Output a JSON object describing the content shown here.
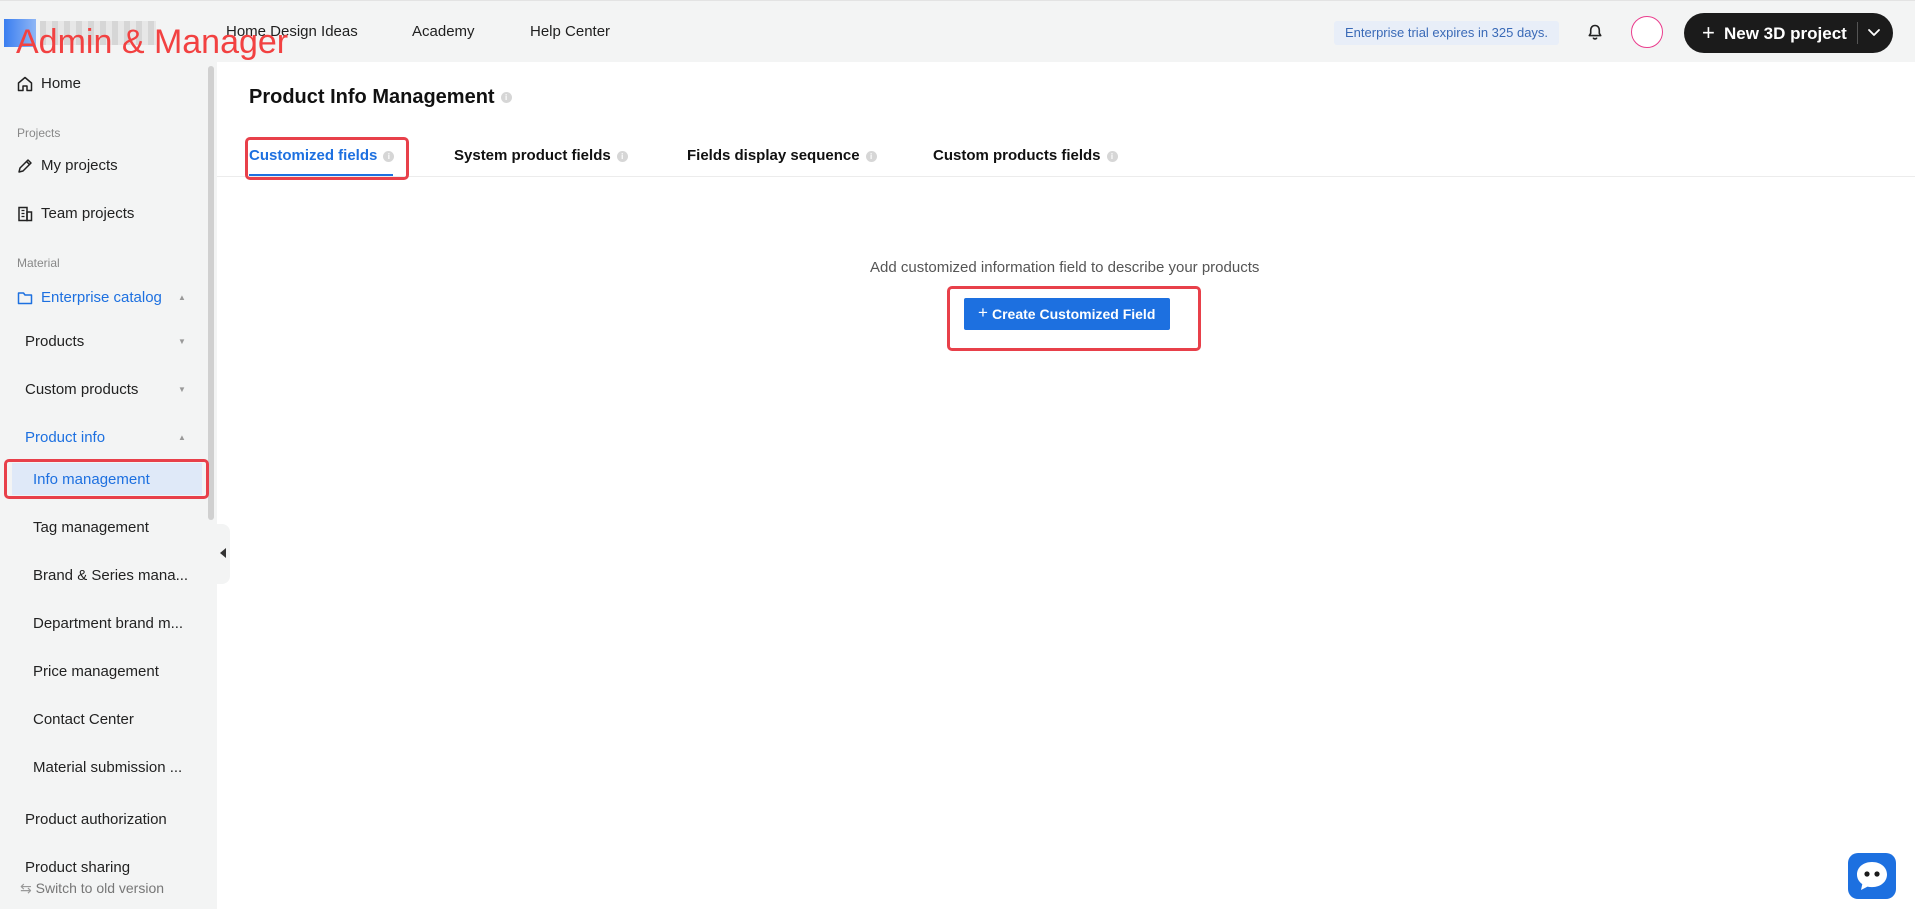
{
  "annotation": {
    "role_label": "Admin & Manager"
  },
  "header": {
    "nav": [
      "Home Design Ideas",
      "Academy",
      "Help Center"
    ],
    "trial_notice": "Enterprise trial expires in 325 days.",
    "new_project_label": "New 3D project"
  },
  "sidebar": {
    "home": "Home",
    "section_projects": "Projects",
    "my_projects": "My projects",
    "team_projects": "Team projects",
    "section_material": "Material",
    "enterprise_catalog": "Enterprise catalog",
    "products": "Products",
    "custom_products": "Custom products",
    "product_info": "Product info",
    "sub_items": [
      "Info management",
      "Tag management",
      "Brand & Series mana...",
      "Department brand m...",
      "Price management",
      "Contact Center",
      "Material submission ..."
    ],
    "product_authorization": "Product authorization",
    "product_sharing": "Product sharing",
    "switch_old": "Switch to old version"
  },
  "main": {
    "title": "Product Info Management",
    "tabs": [
      {
        "label": "Customized fields",
        "active": true
      },
      {
        "label": "System product fields",
        "active": false
      },
      {
        "label": "Fields display sequence",
        "active": false
      },
      {
        "label": "Custom products fields",
        "active": false
      }
    ],
    "empty_message": "Add customized information field to describe your products",
    "create_button": "Create Customized Field"
  },
  "colors": {
    "accent": "#1d70e0",
    "highlight": "#e8404a",
    "role_label": "#f24141"
  },
  "icons": [
    "home-icon",
    "edit-project-icon",
    "building-icon",
    "folder-icon",
    "bell-icon",
    "chevron-down-icon",
    "plus-icon",
    "info-icon",
    "switch-icon",
    "chat-icon",
    "collapse-arrow-icon"
  ]
}
